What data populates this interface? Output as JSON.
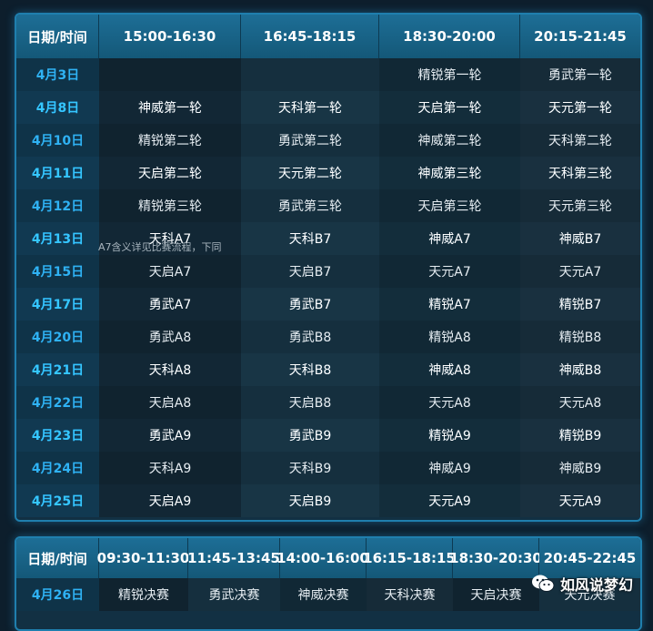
{
  "table1": {
    "headers": [
      "日期/时间",
      "15:00-16:30",
      "16:45-18:15",
      "18:30-20:00",
      "20:15-21:45"
    ],
    "rows": [
      {
        "date": "4月3日",
        "cells": [
          "",
          "",
          "精锐第一轮",
          "勇武第一轮"
        ]
      },
      {
        "date": "4月8日",
        "cells": [
          "神威第一轮",
          "天科第一轮",
          "天启第一轮",
          "天元第一轮"
        ]
      },
      {
        "date": "4月10日",
        "cells": [
          "精锐第二轮",
          "勇武第二轮",
          "神威第二轮",
          "天科第二轮"
        ]
      },
      {
        "date": "4月11日",
        "cells": [
          "天启第二轮",
          "天元第二轮",
          "神威第三轮",
          "天科第三轮"
        ]
      },
      {
        "date": "4月12日",
        "cells": [
          "精锐第三轮",
          "勇武第三轮",
          "天启第三轮",
          "天元第三轮"
        ]
      },
      {
        "date": "4月13日",
        "cells": [
          "天科A7",
          "天科B7",
          "神威A7",
          "神威B7"
        ]
      },
      {
        "date": "4月15日",
        "cells": [
          "天启A7",
          "天启B7",
          "天元A7",
          "天元A7"
        ]
      },
      {
        "date": "4月17日",
        "cells": [
          "勇武A7",
          "勇武B7",
          "精锐A7",
          "精锐B7"
        ]
      },
      {
        "date": "4月20日",
        "cells": [
          "勇武A8",
          "勇武B8",
          "精锐A8",
          "精锐B8"
        ]
      },
      {
        "date": "4月21日",
        "cells": [
          "天科A8",
          "天科B8",
          "神威A8",
          "神威B8"
        ]
      },
      {
        "date": "4月22日",
        "cells": [
          "天启A8",
          "天启B8",
          "天元A8",
          "天元A8"
        ]
      },
      {
        "date": "4月23日",
        "cells": [
          "勇武A9",
          "勇武B9",
          "精锐A9",
          "精锐B9"
        ]
      },
      {
        "date": "4月24日",
        "cells": [
          "天科A9",
          "天科B9",
          "神威A9",
          "神威B9"
        ]
      },
      {
        "date": "4月25日",
        "cells": [
          "天启A9",
          "天启B9",
          "天元A9",
          "天元A9"
        ]
      }
    ]
  },
  "note": "A7含义详见比赛流程，下同",
  "table2": {
    "headers": [
      "日期/时间",
      "09:30-11:30",
      "11:45-13:45",
      "14:00-16:00",
      "16:15-18:15",
      "18:30-20:30",
      "20:45-22:45"
    ],
    "rows": [
      {
        "date": "4月26日",
        "cells": [
          "精锐决赛",
          "勇武决赛",
          "神威决赛",
          "天科决赛",
          "天启决赛",
          "天元决赛"
        ]
      }
    ]
  },
  "watermark": {
    "text": "如风说梦幻",
    "icon": "wechat-icon"
  }
}
